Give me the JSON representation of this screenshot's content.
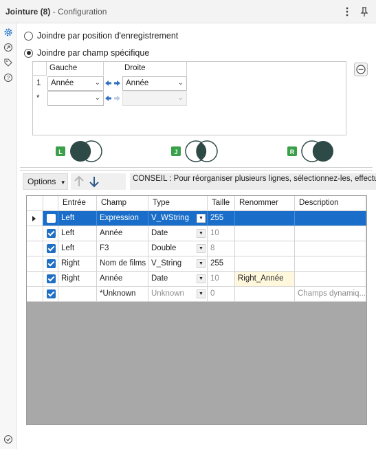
{
  "header": {
    "title": "Jointure (8)",
    "subtitle": "- Configuration"
  },
  "join_options": {
    "by_position_label": "Joindre par position d'enregistrement",
    "by_field_label": "Joindre par champ spécifique",
    "selected": "by_field"
  },
  "join_fields": {
    "left_header": "Gauche",
    "right_header": "Droite",
    "rows": [
      {
        "index": "1",
        "left": "Année",
        "right": "Année"
      },
      {
        "index": "*",
        "left": "",
        "right": ""
      }
    ]
  },
  "venn": [
    {
      "badge": "L",
      "label": "left-join"
    },
    {
      "badge": "J",
      "label": "inner-join"
    },
    {
      "badge": "R",
      "label": "right-join"
    }
  ],
  "toolbar": {
    "options_label": "Options",
    "hint": "CONSEIL : Pour réorganiser plusieurs lignes, sélectionnez-les, effectuez un"
  },
  "table": {
    "columns": [
      "Entrée",
      "Champ",
      "Type",
      "Taille",
      "Renommer",
      "Description"
    ],
    "rows": [
      {
        "checked": true,
        "input": "Left",
        "field": "Expression",
        "type": "V_WString",
        "size": "255",
        "rename": "",
        "description": "",
        "selected": true
      },
      {
        "checked": true,
        "input": "Left",
        "field": "Année",
        "type": "Date",
        "size": "10",
        "rename": "",
        "description": ""
      },
      {
        "checked": true,
        "input": "Left",
        "field": "F3",
        "type": "Double",
        "size": "8",
        "rename": "",
        "description": ""
      },
      {
        "checked": true,
        "input": "Right",
        "field": "Nom de films",
        "type": "V_String",
        "size": "255",
        "rename": "",
        "description": ""
      },
      {
        "checked": true,
        "input": "Right",
        "field": "Année",
        "type": "Date",
        "size": "10",
        "rename": "Right_Année",
        "description": ""
      },
      {
        "checked": true,
        "input": "",
        "field": "*Unknown",
        "type": "Unknown",
        "size": "0",
        "rename": "",
        "description": "Champs dynamiq..."
      }
    ]
  },
  "colors": {
    "accent": "#1a6ec9",
    "badge_green": "#3aa04a",
    "venn_dark": "#2e4a46",
    "table_bg": "#a8a8a8"
  }
}
